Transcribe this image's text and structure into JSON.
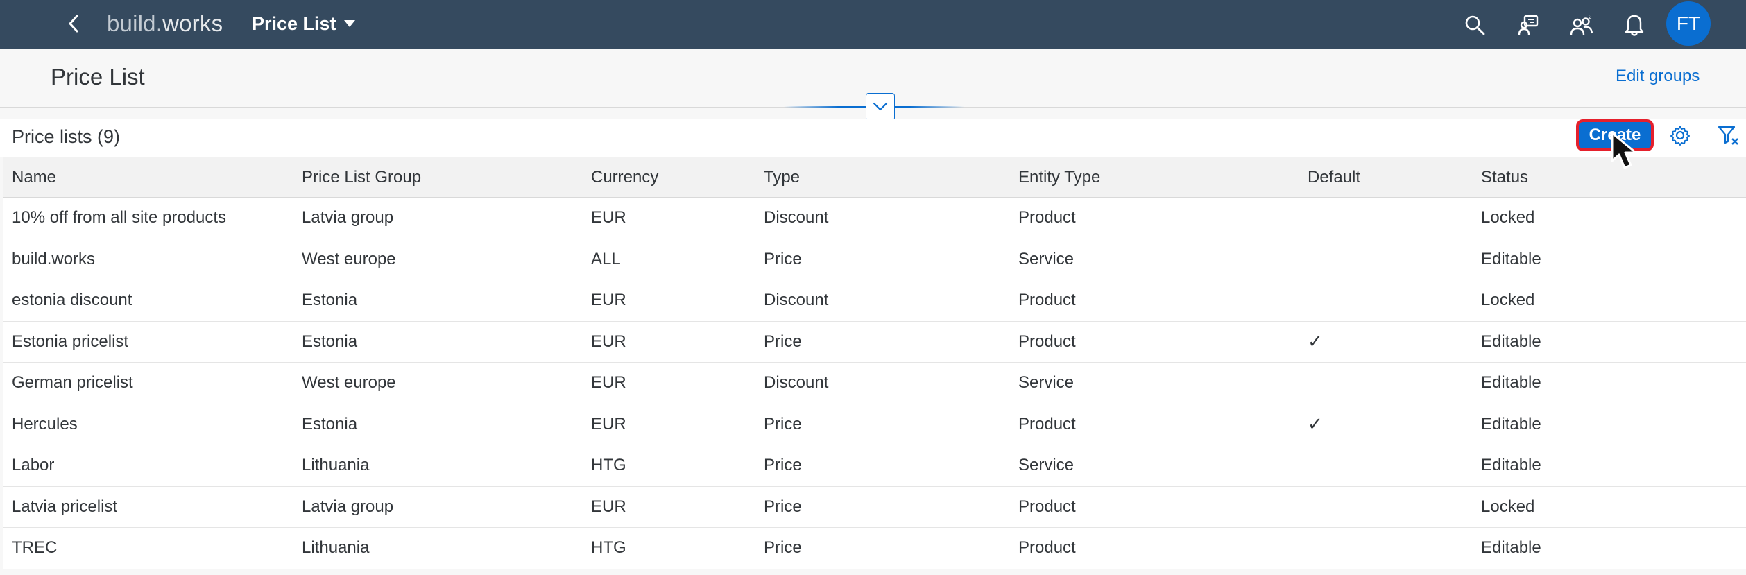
{
  "shell": {
    "logo_main": "build.",
    "logo_sub": "works",
    "app_title": "Price List",
    "avatar_initials": "FT",
    "icons": [
      "search-icon",
      "feedback-icon",
      "team-icon",
      "notification-icon"
    ]
  },
  "header": {
    "page_title": "Price List",
    "edit_groups": "Edit groups"
  },
  "toolbar": {
    "heading": "Price lists (9)",
    "create_label": "Create"
  },
  "table": {
    "columns": [
      "Name",
      "Price List Group",
      "Currency",
      "Type",
      "Entity Type",
      "Default",
      "Status"
    ],
    "rows": [
      {
        "name": "10% off from all site products",
        "group": "Latvia group",
        "currency": "EUR",
        "type": "Discount",
        "entity": "Product",
        "default": "",
        "status": "Locked"
      },
      {
        "name": "build.works",
        "group": "West europe",
        "currency": "ALL",
        "type": "Price",
        "entity": "Service",
        "default": "",
        "status": "Editable"
      },
      {
        "name": "estonia discount",
        "group": "Estonia",
        "currency": "EUR",
        "type": "Discount",
        "entity": "Product",
        "default": "",
        "status": "Locked"
      },
      {
        "name": "Estonia pricelist",
        "group": "Estonia",
        "currency": "EUR",
        "type": "Price",
        "entity": "Product",
        "default": "✓",
        "status": "Editable"
      },
      {
        "name": "German pricelist",
        "group": "West europe",
        "currency": "EUR",
        "type": "Discount",
        "entity": "Service",
        "default": "",
        "status": "Editable"
      },
      {
        "name": "Hercules",
        "group": "Estonia",
        "currency": "EUR",
        "type": "Price",
        "entity": "Product",
        "default": "✓",
        "status": "Editable"
      },
      {
        "name": "Labor",
        "group": "Lithuania",
        "currency": "HTG",
        "type": "Price",
        "entity": "Service",
        "default": "",
        "status": "Editable"
      },
      {
        "name": "Latvia pricelist",
        "group": "Latvia group",
        "currency": "EUR",
        "type": "Price",
        "entity": "Product",
        "default": "",
        "status": "Locked"
      },
      {
        "name": "TREC",
        "group": "Lithuania",
        "currency": "HTG",
        "type": "Price",
        "entity": "Product",
        "default": "",
        "status": "Editable"
      }
    ]
  },
  "colors": {
    "shell_bg": "#354a5f",
    "accent": "#0a6ed1",
    "highlight": "#e5202c"
  }
}
